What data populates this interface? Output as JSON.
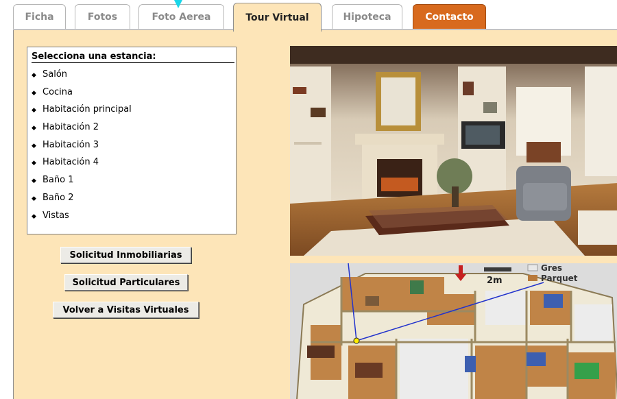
{
  "tabs": [
    {
      "id": "ficha",
      "label": "Ficha"
    },
    {
      "id": "fotos",
      "label": "Fotos"
    },
    {
      "id": "aerea",
      "label": "Foto Aerea"
    },
    {
      "id": "tour",
      "label": "Tour Virtual",
      "active": true
    },
    {
      "id": "hipoteca",
      "label": "Hipoteca"
    },
    {
      "id": "contacto",
      "label": "Contacto"
    }
  ],
  "rooms": {
    "heading": "Selecciona una estancia:",
    "bullet": "◆",
    "items": [
      "Salón",
      "Cocina",
      "Habitación principal",
      "Habitación 2",
      "Habitación 3",
      "Habitación 4",
      "Baño 1",
      "Baño 2",
      "Vistas"
    ]
  },
  "buttons": {
    "inmobiliarias": "Solicitud Inmobiliarias",
    "particulares": "Solicitud Particulares",
    "volver": "Volver a Visitas Virtuales"
  },
  "floorplan": {
    "scale_label": "2m",
    "legend": [
      {
        "label": "Gres",
        "color": "#e8e8e8"
      },
      {
        "label": "Parquet",
        "color": "#b8793a"
      }
    ]
  },
  "colors": {
    "panel_bg": "#fde5b8",
    "contact_tab": "#d86a1e",
    "cursor": "#19d6e8"
  }
}
